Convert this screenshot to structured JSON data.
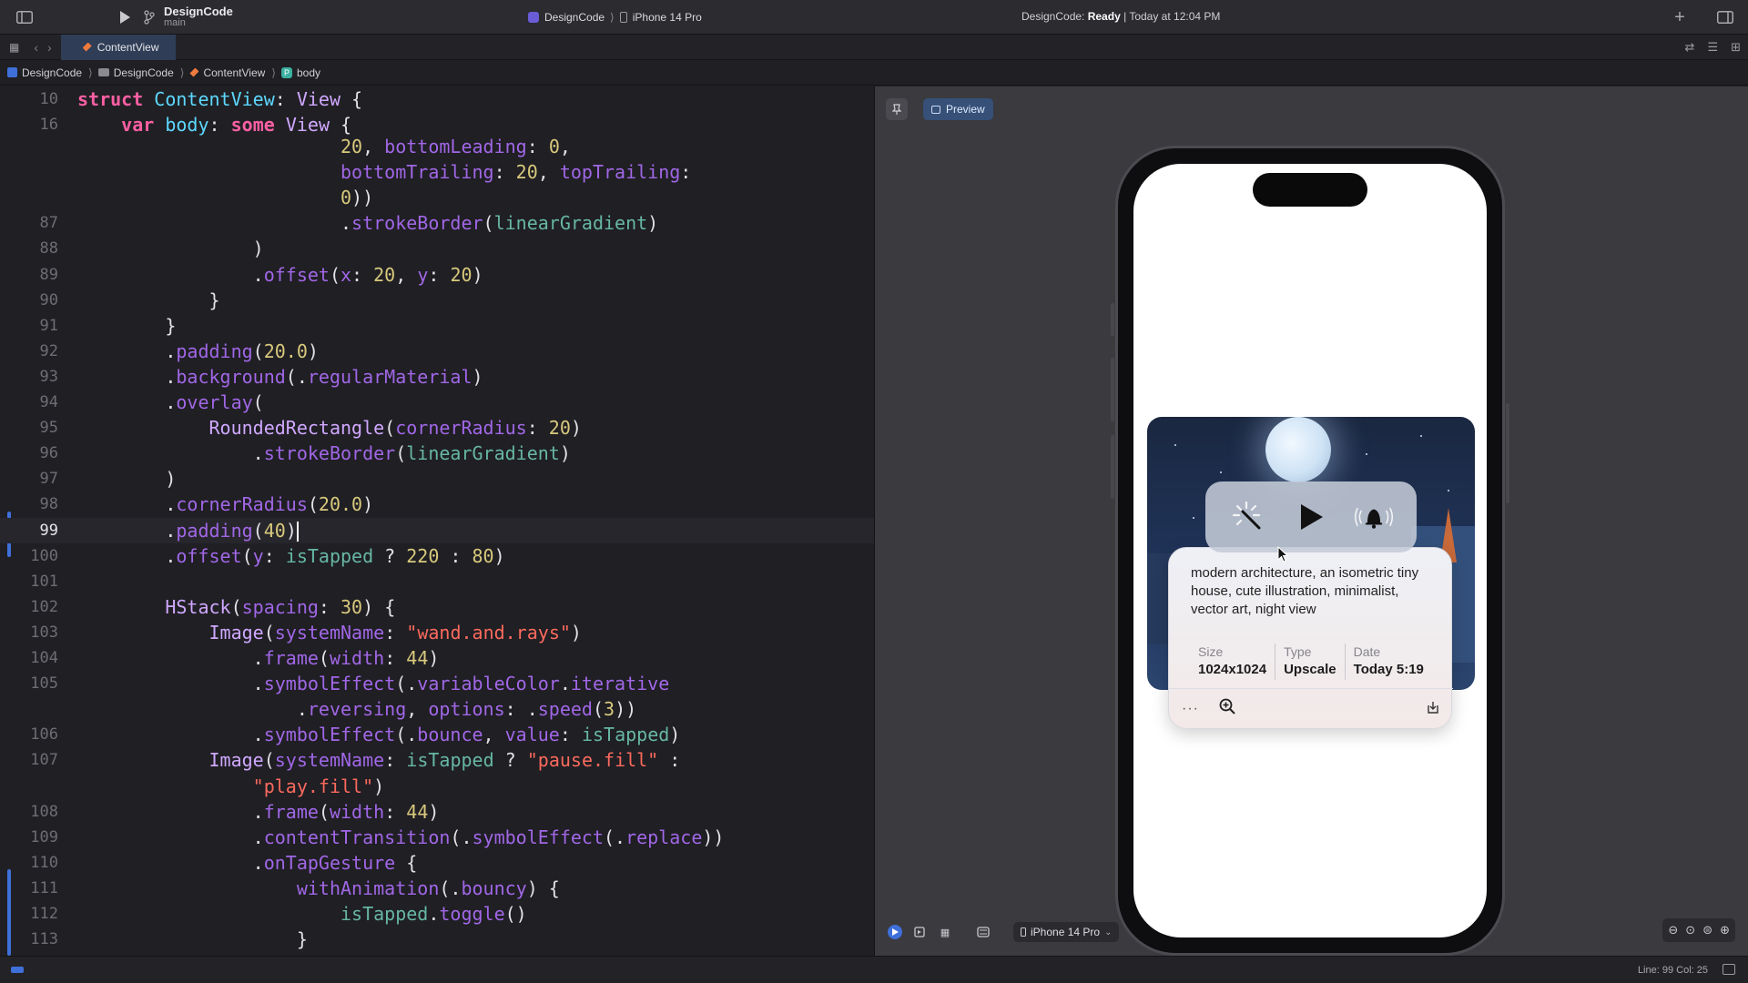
{
  "toolbar": {
    "project_name": "DesignCode",
    "branch": "main",
    "scheme": "DesignCode",
    "device": "iPhone 14 Pro",
    "status_app": "DesignCode:",
    "status_state": "Ready",
    "status_time": "| Today at 12:04 PM"
  },
  "tabs": [
    {
      "label": "ContentView"
    }
  ],
  "breadcrumb": [
    "DesignCode",
    "DesignCode",
    "ContentView",
    "body"
  ],
  "code_lines": [
    {
      "n": "10",
      "html": "<span class='kw'>struct</span> <span class='id'>ContentView</span>: <span class='ty'>View</span> {"
    },
    {
      "n": "16",
      "html": "    <span class='kw'>var</span> <span class='id'>body</span>: <span class='kw'>some</span> <span class='ty'>View</span> {"
    },
    {
      "n": "",
      "html": "                        <span class='num'>20</span>, <span class='fn'>bottomLeading</span>: <span class='num'>0</span>,"
    },
    {
      "n": "",
      "html": "                        <span class='fn'>bottomTrailing</span>: <span class='num'>20</span>, <span class='fn'>topTrailing</span>:"
    },
    {
      "n": "",
      "html": "                        <span class='num'>0</span>))"
    },
    {
      "n": "87",
      "html": "                        .<span class='fn'>strokeBorder</span>(<span class='mem'>linearGradient</span>)"
    },
    {
      "n": "88",
      "html": "                )"
    },
    {
      "n": "89",
      "html": "                .<span class='fn'>offset</span>(<span class='fn'>x</span>: <span class='num'>20</span>, <span class='fn'>y</span>: <span class='num'>20</span>)"
    },
    {
      "n": "90",
      "html": "            }"
    },
    {
      "n": "91",
      "html": "        }"
    },
    {
      "n": "92",
      "html": "        .<span class='fn'>padding</span>(<span class='num'>20.0</span>)"
    },
    {
      "n": "93",
      "html": "        .<span class='fn'>background</span>(.<span class='fn'>regularMaterial</span>)"
    },
    {
      "n": "94",
      "html": "        .<span class='fn'>overlay</span>("
    },
    {
      "n": "95",
      "html": "            <span class='ty'>RoundedRectangle</span>(<span class='fn'>cornerRadius</span>: <span class='num'>20</span>)"
    },
    {
      "n": "96",
      "html": "                .<span class='fn'>strokeBorder</span>(<span class='mem'>linearGradient</span>)"
    },
    {
      "n": "97",
      "html": "        )"
    },
    {
      "n": "98",
      "html": "        .<span class='fn'>cornerRadius</span>(<span class='num'>20.0</span>)"
    },
    {
      "n": "99",
      "html": "        .<span class='fn'>padding</span>(<span class='num'>40</span>)<span class='cursor'></span>",
      "current": true
    },
    {
      "n": "100",
      "html": "        .<span class='fn'>offset</span>(<span class='fn'>y</span>: <span class='mem'>isTapped</span> ? <span class='num'>220</span> : <span class='num'>80</span>)"
    },
    {
      "n": "101",
      "html": ""
    },
    {
      "n": "102",
      "html": "        <span class='ty'>HStack</span>(<span class='fn'>spacing</span>: <span class='num'>30</span>) {"
    },
    {
      "n": "103",
      "html": "            <span class='ty'>Image</span>(<span class='fn'>systemName</span>: <span class='str'>\"wand.and.rays\"</span>)"
    },
    {
      "n": "104",
      "html": "                .<span class='fn'>frame</span>(<span class='fn'>width</span>: <span class='num'>44</span>)"
    },
    {
      "n": "105",
      "html": "                .<span class='fn'>symbolEffect</span>(.<span class='fn'>variableColor</span>.<span class='fn'>iterative</span>"
    },
    {
      "n": "",
      "html": "                    .<span class='fn'>reversing</span>, <span class='fn'>options</span>: .<span class='fn'>speed</span>(<span class='num'>3</span>))"
    },
    {
      "n": "106",
      "html": "                .<span class='fn'>symbolEffect</span>(.<span class='fn'>bounce</span>, <span class='fn'>value</span>: <span class='mem'>isTapped</span>)"
    },
    {
      "n": "107",
      "html": "            <span class='ty'>Image</span>(<span class='fn'>systemName</span>: <span class='mem'>isTapped</span> ? <span class='str'>\"pause.fill\"</span> :"
    },
    {
      "n": "",
      "html": "                <span class='str'>\"play.fill\"</span>)"
    },
    {
      "n": "108",
      "html": "                .<span class='fn'>frame</span>(<span class='fn'>width</span>: <span class='num'>44</span>)"
    },
    {
      "n": "109",
      "html": "                .<span class='fn'>contentTransition</span>(.<span class='fn'>symbolEffect</span>(.<span class='fn'>replace</span>))"
    },
    {
      "n": "110",
      "html": "                .<span class='fn'>onTapGesture</span> {"
    },
    {
      "n": "111",
      "html": "                    <span class='fn'>withAnimation</span>(.<span class='fn'>bouncy</span>) {"
    },
    {
      "n": "112",
      "html": "                        <span class='mem'>isTapped</span>.<span class='fn'>toggle</span>()"
    },
    {
      "n": "113",
      "html": "                    }"
    },
    {
      "n": "114",
      "html": "                }"
    }
  ],
  "preview": {
    "button_label": "Preview",
    "device_label": "iPhone 14 Pro",
    "card": {
      "description": "modern architecture, an isometric tiny house, cute illustration, minimalist, vector art, night view",
      "meta": [
        {
          "key": "Size",
          "value": "1024x1024"
        },
        {
          "key": "Type",
          "value": "Upscale"
        },
        {
          "key": "Date",
          "value": "Today 5:19"
        }
      ],
      "more_label": "···"
    },
    "controls": [
      "wand-and-rays-icon",
      "play-fill-icon",
      "bell-wave-icon"
    ]
  },
  "statusbar": {
    "position": "Line: 99  Col: 25"
  },
  "colors": {
    "accent": "#3f6fd9",
    "preview_button": "#365078",
    "tab_active": "#2f3d56"
  }
}
